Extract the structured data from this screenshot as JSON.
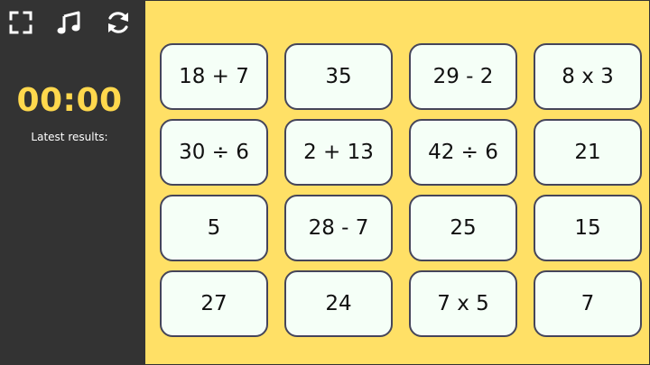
{
  "toolbar": {
    "buttons": [
      {
        "icon": "fullscreen-icon"
      },
      {
        "icon": "music-icon"
      },
      {
        "icon": "restart-icon"
      }
    ]
  },
  "sidebar": {
    "timer": "00:00",
    "results_label": "Latest results:"
  },
  "cards": [
    "18 + 7",
    "35",
    "29 - 2",
    "8 x 3",
    "30 ÷ 6",
    "2 + 13",
    "42 ÷ 6",
    "21",
    "5",
    "28 - 7",
    "25",
    "15",
    "27",
    "24",
    "7 x 5",
    "7"
  ],
  "colors": {
    "background": "#ffe066",
    "sidebar": "#333333",
    "timer": "#ffd84d",
    "card_fill": "#f5fff7",
    "card_border": "#45455a"
  }
}
